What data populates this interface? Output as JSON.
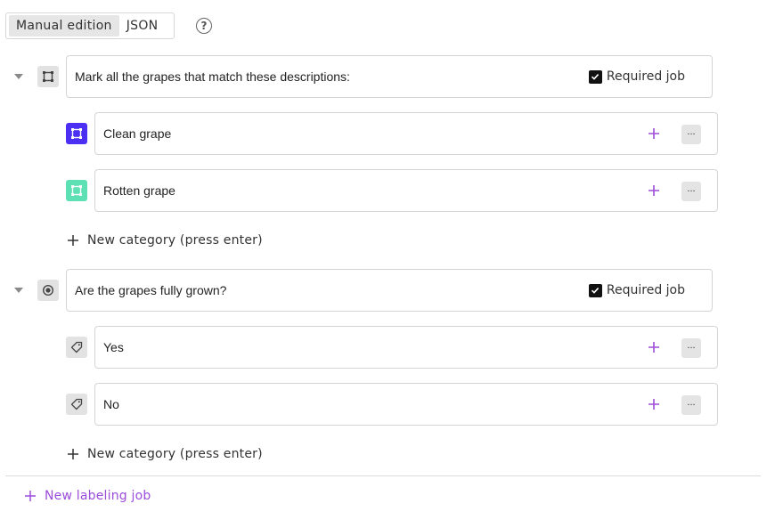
{
  "tabs": {
    "manual": "Manual edition",
    "json": "JSON"
  },
  "help_icon": "?",
  "jobs": [
    {
      "title": "Mark all the grapes that match these descriptions:",
      "required_label": "Required job",
      "icon": "bounding-box-icon",
      "categories": [
        {
          "label": "Clean grape",
          "color": "#4b2ff2",
          "icon": "bounding-box-icon"
        },
        {
          "label": "Rotten grape",
          "color": "#5ee0b5",
          "icon": "bounding-box-icon"
        }
      ],
      "new_category": "New category (press enter)"
    },
    {
      "title": "Are the grapes fully grown?",
      "required_label": "Required job",
      "icon": "radio-icon",
      "categories": [
        {
          "label": "Yes",
          "color": "#e2e2e2",
          "icon": "tag-icon"
        },
        {
          "label": "No",
          "color": "#e2e2e2",
          "icon": "tag-icon"
        }
      ],
      "new_category": "New category (press enter)"
    }
  ],
  "more_label": "...",
  "new_job": "New labeling job",
  "colors": {
    "accent": "#9b4ddb"
  }
}
